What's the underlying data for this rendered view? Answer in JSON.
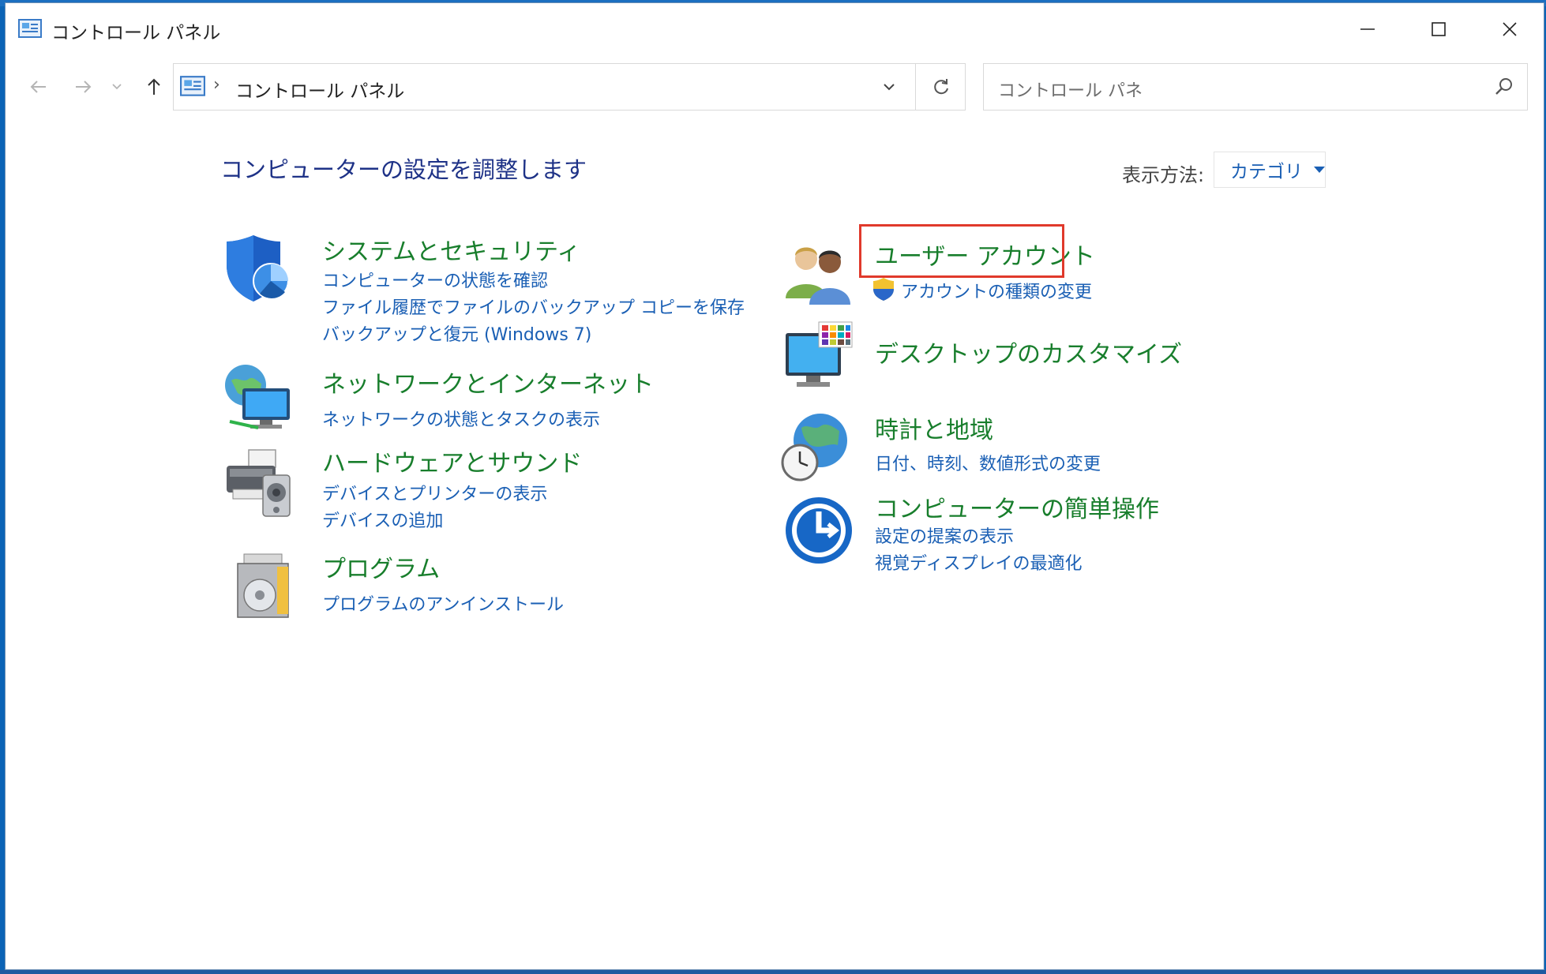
{
  "window": {
    "title": "コントロール パネル",
    "controls": [
      "minimize",
      "maximize",
      "close"
    ]
  },
  "address_bar": {
    "path": "コントロール パネル",
    "separator": "›"
  },
  "search": {
    "placeholder": "コントロール パネ"
  },
  "main": {
    "heading": "コンピューターの設定を調整します",
    "view_by": {
      "label": "表示方法:",
      "value": "カテゴリ"
    }
  },
  "categories": [
    {
      "title": "システムとセキュリティ",
      "icon": "shield-icon",
      "links": [
        "コンピューターの状態を確認",
        "ファイル履歴でファイルのバックアップ コピーを保存",
        "バックアップと復元 (Windows 7)"
      ]
    },
    {
      "title": "ネットワークとインターネット",
      "icon": "network-globe-icon",
      "links": [
        "ネットワークの状態とタスクの表示"
      ]
    },
    {
      "title": "ハードウェアとサウンド",
      "icon": "printer-speaker-icon",
      "links": [
        "デバイスとプリンターの表示",
        "デバイスの追加"
      ]
    },
    {
      "title": "プログラム",
      "icon": "programs-disc-icon",
      "links": [
        "プログラムのアンインストール"
      ]
    },
    {
      "title": "ユーザー アカウント",
      "icon": "users-icon",
      "highlighted": true,
      "links": [
        "アカウントの種類の変更"
      ]
    },
    {
      "title": "デスクトップのカスタマイズ",
      "icon": "monitor-palette-icon",
      "links": []
    },
    {
      "title": "時計と地域",
      "icon": "clock-globe-icon",
      "links": [
        "日付、時刻、数値形式の変更"
      ]
    },
    {
      "title": "コンピューターの簡単操作",
      "icon": "ease-of-access-icon",
      "links": [
        "設定の提案の表示",
        "視覚ディスプレイの最適化"
      ]
    }
  ],
  "colors": {
    "category_title": "#187e2c",
    "link": "#1a5fb4",
    "heading": "#1e3287",
    "highlight_border": "#e0392b"
  }
}
